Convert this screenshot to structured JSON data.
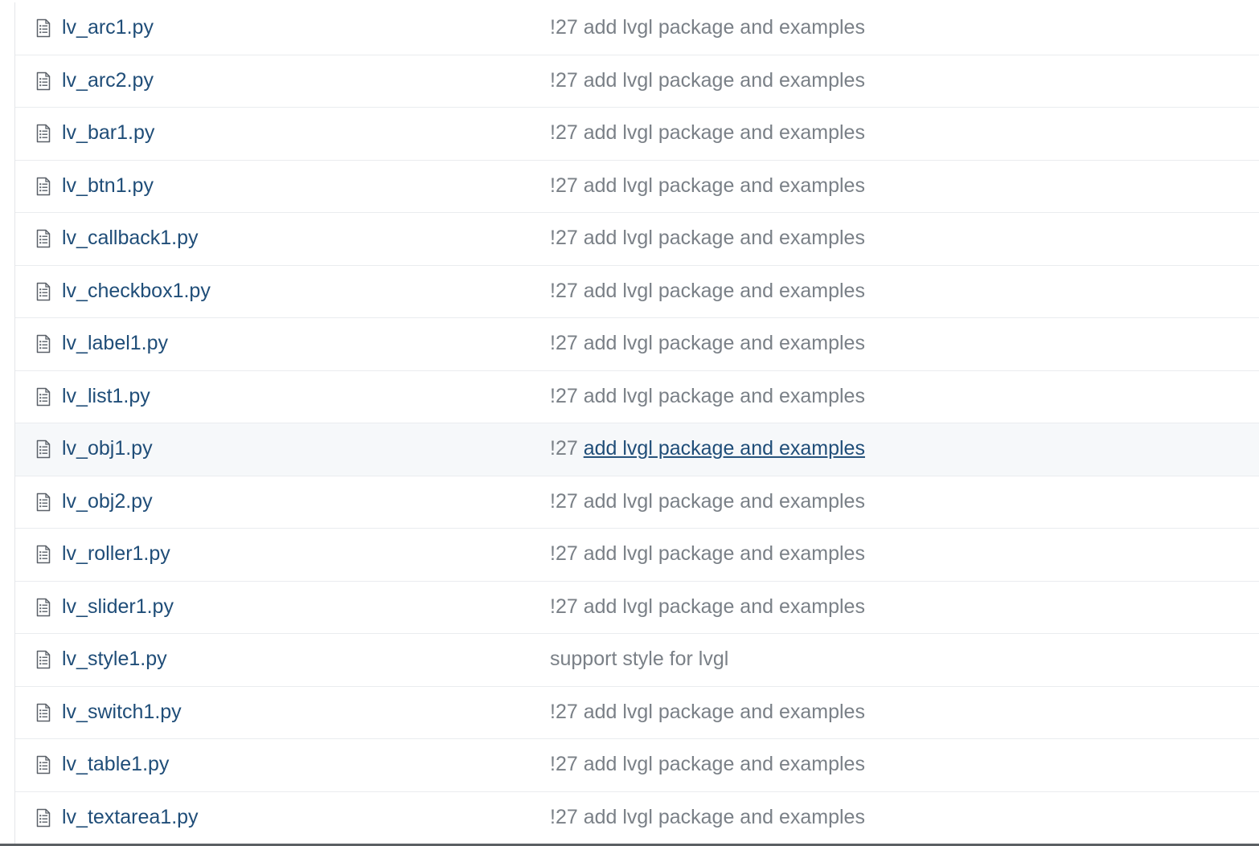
{
  "files": [
    {
      "name": "lv_arc1.py",
      "ref": "!27",
      "message": "add lvgl package and examples"
    },
    {
      "name": "lv_arc2.py",
      "ref": "!27",
      "message": "add lvgl package and examples"
    },
    {
      "name": "lv_bar1.py",
      "ref": "!27",
      "message": "add lvgl package and examples"
    },
    {
      "name": "lv_btn1.py",
      "ref": "!27",
      "message": "add lvgl package and examples"
    },
    {
      "name": "lv_callback1.py",
      "ref": "!27",
      "message": "add lvgl package and examples"
    },
    {
      "name": "lv_checkbox1.py",
      "ref": "!27",
      "message": "add lvgl package and examples"
    },
    {
      "name": "lv_label1.py",
      "ref": "!27",
      "message": "add lvgl package and examples"
    },
    {
      "name": "lv_list1.py",
      "ref": "!27",
      "message": "add lvgl package and examples"
    },
    {
      "name": "lv_obj1.py",
      "ref": "!27",
      "message": "add lvgl package and examples"
    },
    {
      "name": "lv_obj2.py",
      "ref": "!27",
      "message": "add lvgl package and examples"
    },
    {
      "name": "lv_roller1.py",
      "ref": "!27",
      "message": "add lvgl package and examples"
    },
    {
      "name": "lv_slider1.py",
      "ref": "!27",
      "message": "add lvgl package and examples"
    },
    {
      "name": "lv_style1.py",
      "ref": "",
      "message": "support style for lvgl"
    },
    {
      "name": "lv_switch1.py",
      "ref": "!27",
      "message": "add lvgl package and examples"
    },
    {
      "name": "lv_table1.py",
      "ref": "!27",
      "message": "add lvgl package and examples"
    },
    {
      "name": "lv_textarea1.py",
      "ref": "!27",
      "message": "add lvgl package and examples"
    }
  ],
  "hovered_row": 8,
  "icon": "file-text-icon",
  "colors": {
    "link": "#1f4d78",
    "muted": "#7a8087",
    "hover_bg": "#f6f8fa",
    "divider": "#eaecef"
  }
}
